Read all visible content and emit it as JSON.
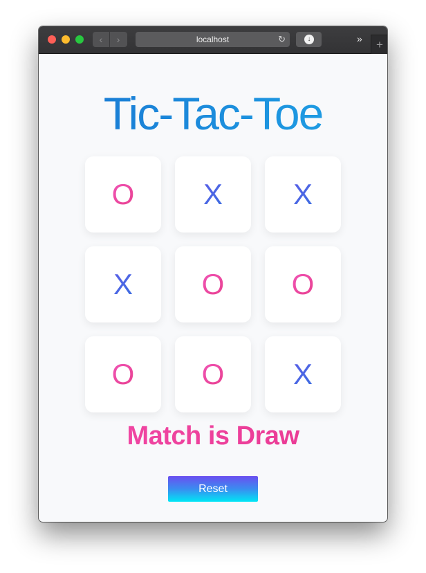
{
  "browser": {
    "url": "localhost",
    "icons": {
      "back": "chevron-left-icon",
      "forward": "chevron-right-icon",
      "reload": "reload-icon",
      "download": "download-icon",
      "overflow": "double-chevron-right-icon",
      "new_tab": "plus-icon"
    }
  },
  "game": {
    "title": "Tic-Tac-Toe",
    "board": [
      "O",
      "X",
      "X",
      "X",
      "O",
      "O",
      "O",
      "O",
      "X"
    ],
    "status": "Match is Draw",
    "reset_label": "Reset"
  },
  "colors": {
    "title_gradient": [
      "#1976d2",
      "#1fa3e6"
    ],
    "x_mark": "#4f63e6",
    "o_mark": "#ec4aa3",
    "status": "#ee3f9b",
    "reset_gradient": [
      "#6b4ff0",
      "#00e6f5"
    ]
  }
}
